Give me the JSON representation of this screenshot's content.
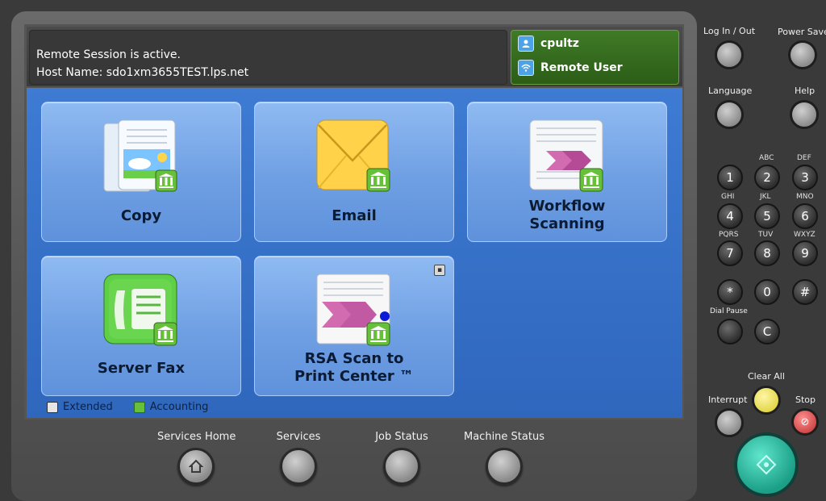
{
  "header": {
    "message_line1": "Remote Session is active.",
    "message_line2": "Host Name: sdo1xm3655TEST.lps.net",
    "user_name": "cpultz",
    "remote_label": "Remote User"
  },
  "tiles": [
    {
      "label1": "Copy",
      "label2": "",
      "icon": "copy-icon"
    },
    {
      "label1": "Email",
      "label2": "",
      "icon": "email-icon"
    },
    {
      "label1": "Workflow",
      "label2": "Scanning",
      "icon": "workflow-scanning-icon"
    },
    {
      "label1": "Server Fax",
      "label2": "",
      "icon": "server-fax-icon"
    },
    {
      "label1": "RSA Scan to",
      "label2": "Print Center ™",
      "icon": "rsa-scan-icon"
    }
  ],
  "legend": {
    "extended": "Extended",
    "accounting": "Accounting"
  },
  "bottom_nav": {
    "services_home": "Services Home",
    "services": "Services",
    "job_status": "Job Status",
    "machine_status": "Machine Status"
  },
  "right_panel": {
    "log_in_out": "Log In / Out",
    "power_saver": "Power Saver",
    "language": "Language",
    "help": "Help",
    "dial_pause": "Dial Pause",
    "clear_all": "Clear All",
    "interrupt": "Interrupt",
    "stop": "Stop",
    "keypad": [
      {
        "k": "1",
        "s": ""
      },
      {
        "k": "2",
        "s": "ABC"
      },
      {
        "k": "3",
        "s": "DEF"
      },
      {
        "k": "4",
        "s": "GHI"
      },
      {
        "k": "5",
        "s": "JKL"
      },
      {
        "k": "6",
        "s": "MNO"
      },
      {
        "k": "7",
        "s": "PQRS"
      },
      {
        "k": "8",
        "s": "TUV"
      },
      {
        "k": "9",
        "s": "WXYZ"
      },
      {
        "k": "*",
        "s": ""
      },
      {
        "k": "0",
        "s": ""
      },
      {
        "k": "#",
        "s": ""
      },
      {
        "k": "C",
        "s": ""
      }
    ]
  },
  "colors": {
    "main_bg": "#3e7bd3",
    "tile_bg": "#7aa9ea",
    "user_bg": "#3f7a26",
    "accounting": "#67c03a",
    "start": "#1b9f86"
  }
}
